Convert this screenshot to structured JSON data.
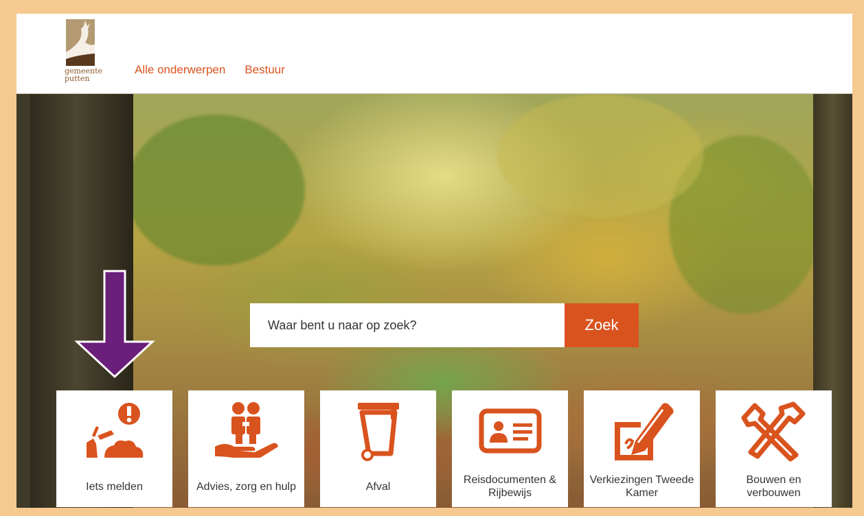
{
  "logo": {
    "line1": "gemeente",
    "line2": "putten"
  },
  "nav": {
    "items": [
      "Alle onderwerpen",
      "Bestuur"
    ]
  },
  "search": {
    "placeholder": "Waar bent u naar op zoek?",
    "button_label": "Zoek"
  },
  "tiles": [
    {
      "label": "Iets melden",
      "icon": "report-icon"
    },
    {
      "label": "Advies, zorg en hulp",
      "icon": "care-hand-icon"
    },
    {
      "label": "Afval",
      "icon": "waste-bin-icon"
    },
    {
      "label": "Reisdocumenten & Rijbewijs",
      "icon": "id-card-icon"
    },
    {
      "label": "Verkiezingen Tweede Kamer",
      "icon": "ballot-pencil-icon"
    },
    {
      "label": "Bouwen en verbouwen",
      "icon": "hammer-wrench-icon"
    }
  ],
  "colors": {
    "accent": "#d9531e",
    "arrow": "#6a1f7a",
    "frame": "#f5c98f"
  }
}
